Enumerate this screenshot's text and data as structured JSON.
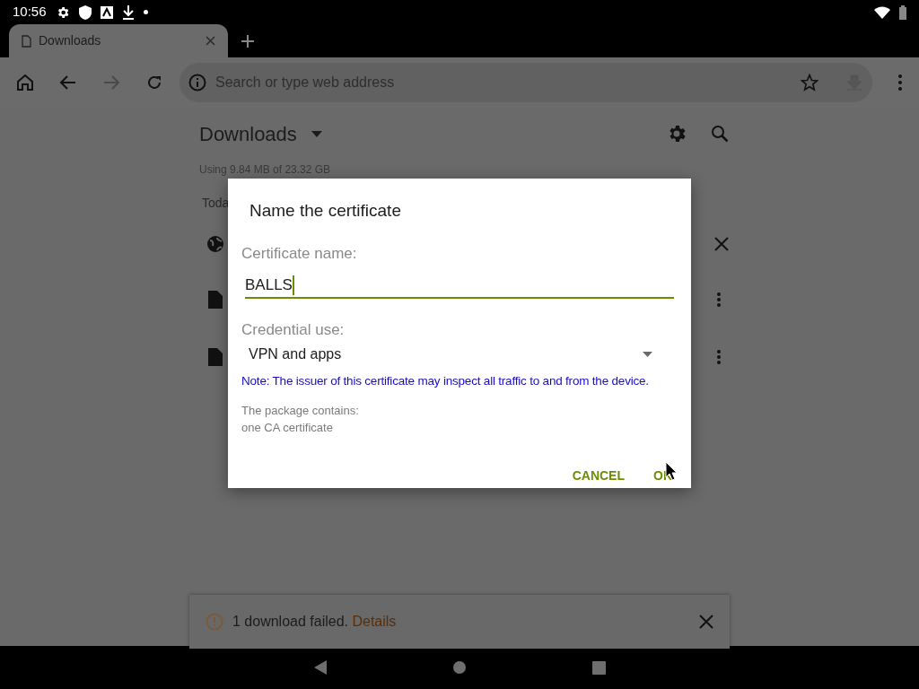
{
  "status_bar": {
    "time": "10:56"
  },
  "tabs": [
    {
      "title": "Downloads",
      "selected": true
    }
  ],
  "address_bar": {
    "placeholder": "Search or type web address"
  },
  "page": {
    "title": "Downloads",
    "storage": "Using 9.84 MB of 23.32 GB",
    "section": "Toda"
  },
  "dialog": {
    "title": "Name the certificate",
    "name_label": "Certificate name:",
    "name_value": "BALLS",
    "use_label": "Credential use:",
    "use_value": "VPN and apps",
    "note": "Note: The issuer of this certificate may inspect all traffic to and from the device.",
    "package_info": "The package contains:",
    "package_item": "one CA certificate",
    "buttons": [
      "CANCEL",
      "OK"
    ]
  },
  "snackbar": {
    "message": "1 download failed.",
    "link": "Details"
  }
}
